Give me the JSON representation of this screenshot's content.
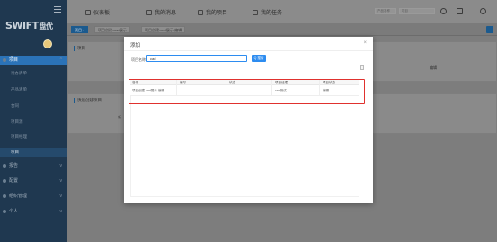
{
  "sidebar": {
    "logo_text": "SWIFT",
    "logo_cn": "盘优",
    "items": [
      {
        "label": "项目",
        "active": true
      },
      {
        "label": "待办清单",
        "sub": true
      },
      {
        "label": "产品清单",
        "sub": true
      },
      {
        "label": "合同",
        "sub": true
      },
      {
        "label": "项目源",
        "sub": true
      },
      {
        "label": "项目经理",
        "sub": true
      },
      {
        "label": "项目",
        "sub": true,
        "active": true
      },
      {
        "label": "报告"
      },
      {
        "label": "配置"
      },
      {
        "label": "组织管理"
      },
      {
        "label": "个人"
      }
    ]
  },
  "topbar": {
    "nav": [
      "仪表板",
      "我的消息",
      "我的项目",
      "我的任务"
    ],
    "select1": "产品名称",
    "select2": "项目"
  },
  "tabs": {
    "home": "项目",
    "tab1": "项目创建-cad展示",
    "tab2": "项目创建-cad展示-编辑"
  },
  "background": {
    "panel1_title": "项目",
    "panel1_col": "编辑",
    "panel2_title": "快速创建项目",
    "panel2_btn": "新"
  },
  "modal": {
    "title": "添加",
    "close": "×",
    "search_label": "项目名称",
    "search_value": "cad",
    "search_button": "Q 搜索",
    "columns": [
      "名称",
      "编号",
      "状态",
      "项目经理",
      "项目状态"
    ],
    "rows": [
      [
        "项目创建-cad展示-编辑",
        "",
        "",
        "cad测试",
        "编辑"
      ]
    ]
  }
}
